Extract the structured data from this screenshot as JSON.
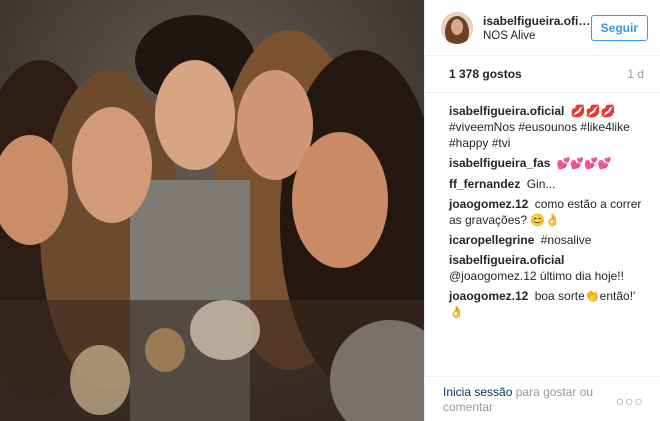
{
  "post": {
    "username": "isabelfigueira.oficial",
    "location": "NOS Alive",
    "follow_label": "Seguir",
    "likes": "1 378 gostos",
    "time": "1 d"
  },
  "comments": [
    {
      "author": "isabelfigueira.oficial",
      "text": "💋💋💋#viveemNos #eusounos #like4like #happy #tvi"
    },
    {
      "author": "isabelfigueira_fas",
      "text": "💕💕💕💕"
    },
    {
      "author": "ff_fernandez",
      "text": "Gin..."
    },
    {
      "author": "joaogomez.12",
      "text": "como estão a correr as gravações? 😊👌"
    },
    {
      "author": "icaropellegrine",
      "text": "#nosalive"
    },
    {
      "author": "isabelfigueira.oficial",
      "text": "@joaogomez.12 último dia hoje!!"
    },
    {
      "author": "joaogomez.12",
      "text": "boa sorte👏então!' 👌"
    }
  ],
  "footer": {
    "login_link": "Inicia sessão",
    "login_suffix": "para gostar ou comentar",
    "more": "○○○"
  },
  "icons": {
    "more": "more-options-icon"
  }
}
